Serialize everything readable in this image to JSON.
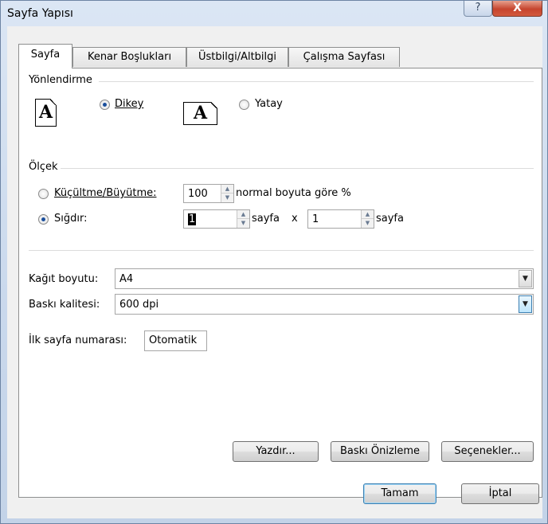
{
  "window": {
    "title": "Sayfa Yapısı",
    "help_glyph": "?",
    "close_glyph": "X"
  },
  "tabs": [
    {
      "label": "Sayfa",
      "active": true
    },
    {
      "label": "Kenar Boşlukları",
      "active": false
    },
    {
      "label": "Üstbilgi/Altbilgi",
      "active": false
    },
    {
      "label": "Çalışma Sayfası",
      "active": false
    }
  ],
  "orientation": {
    "group_label": "Yönlendirme",
    "portrait_icon_letter": "A",
    "portrait_label": "Dikey",
    "landscape_icon_letter": "A",
    "landscape_label": "Yatay",
    "selected": "Dikey"
  },
  "scale": {
    "group_label": "Ölçek",
    "adjust_label": "Küçültme/Büyütme:",
    "adjust_value": "100",
    "adjust_suffix": "normal boyuta göre %",
    "fit_label": "Sığdır:",
    "fit_wide_value": "1",
    "fit_wide_suffix": "sayfa",
    "fit_x": "x",
    "fit_tall_value": "1",
    "fit_tall_suffix": "sayfa",
    "selected": "Sığdır:"
  },
  "paper": {
    "paper_size_label": "Kağıt boyutu:",
    "paper_size_value": "A4",
    "print_quality_label": "Baskı kalitesi:",
    "print_quality_value": "600 dpi",
    "first_page_label": "İlk sayfa numarası:",
    "first_page_value": "Otomatik"
  },
  "panel_buttons": {
    "print": "Yazdır...",
    "print_preview": "Baskı Önizleme",
    "options": "Seçenekler..."
  },
  "dialog_buttons": {
    "ok": "Tamam",
    "cancel": "İptal"
  },
  "icons": {
    "spin_up": "▲",
    "spin_down": "▼",
    "dropdown": "▼"
  }
}
